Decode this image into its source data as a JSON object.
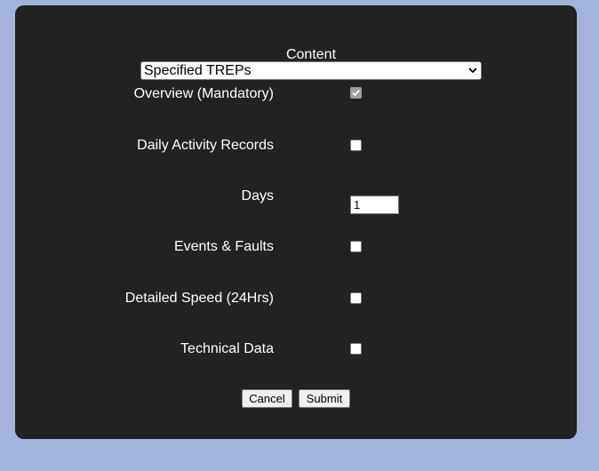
{
  "form": {
    "content_label": "Content",
    "content_select": {
      "selected": "Specified TREPs"
    },
    "overview": {
      "label": "Overview (Mandatory)",
      "checked": true,
      "disabled": true
    },
    "daily_activity": {
      "label": "Daily Activity Records",
      "checked": false
    },
    "days": {
      "label": "Days",
      "value": "1"
    },
    "events_faults": {
      "label": "Events & Faults",
      "checked": false
    },
    "detailed_speed": {
      "label": "Detailed Speed (24Hrs)",
      "checked": false
    },
    "technical_data": {
      "label": "Technical Data",
      "checked": false
    },
    "cancel_label": "Cancel",
    "submit_label": "Submit"
  },
  "colors": {
    "page_background": "#a3b3db",
    "panel_background": "#212321",
    "text": "#ffffff"
  }
}
